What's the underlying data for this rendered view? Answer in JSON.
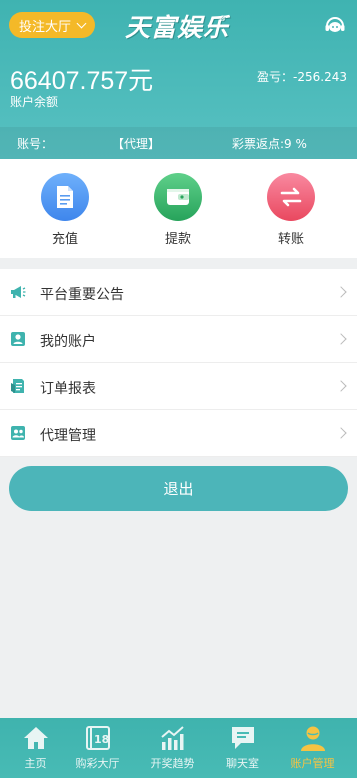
{
  "header": {
    "bet_hall_label": "投注大厅",
    "logo_text": "天富娱乐",
    "logo_mark": "®",
    "balance": "66407.757元",
    "balance_label": "账户余额",
    "profit": "盈亏：-256.243",
    "account_label": "账号：",
    "role": "【代理】",
    "rebate": "彩票返点:9 %"
  },
  "actions": [
    {
      "label": "充值",
      "icon": "document-icon",
      "color": "#3f8ef0"
    },
    {
      "label": "提款",
      "icon": "wallet-icon",
      "color": "#2fb068"
    },
    {
      "label": "转账",
      "icon": "transfer-icon",
      "color": "#ee5a72"
    }
  ],
  "menu": [
    {
      "label": "平台重要公告",
      "icon": "megaphone-icon"
    },
    {
      "label": "我的账户",
      "icon": "user-card-icon"
    },
    {
      "label": "订单报表",
      "icon": "report-icon"
    },
    {
      "label": "代理管理",
      "icon": "agent-icon"
    }
  ],
  "logout_label": "退出",
  "tabs": [
    {
      "label": "主页",
      "icon": "home-icon",
      "active": false
    },
    {
      "label": "购彩大厅",
      "icon": "lottery-icon",
      "active": false
    },
    {
      "label": "开奖趋势",
      "icon": "trend-icon",
      "active": false
    },
    {
      "label": "聊天室",
      "icon": "chat-icon",
      "active": false
    },
    {
      "label": "账户管理",
      "icon": "account-icon",
      "active": true
    }
  ],
  "colors": {
    "primary": "#4cb5b9",
    "accent": "#f4b928",
    "active_tab": "#f6c343"
  }
}
